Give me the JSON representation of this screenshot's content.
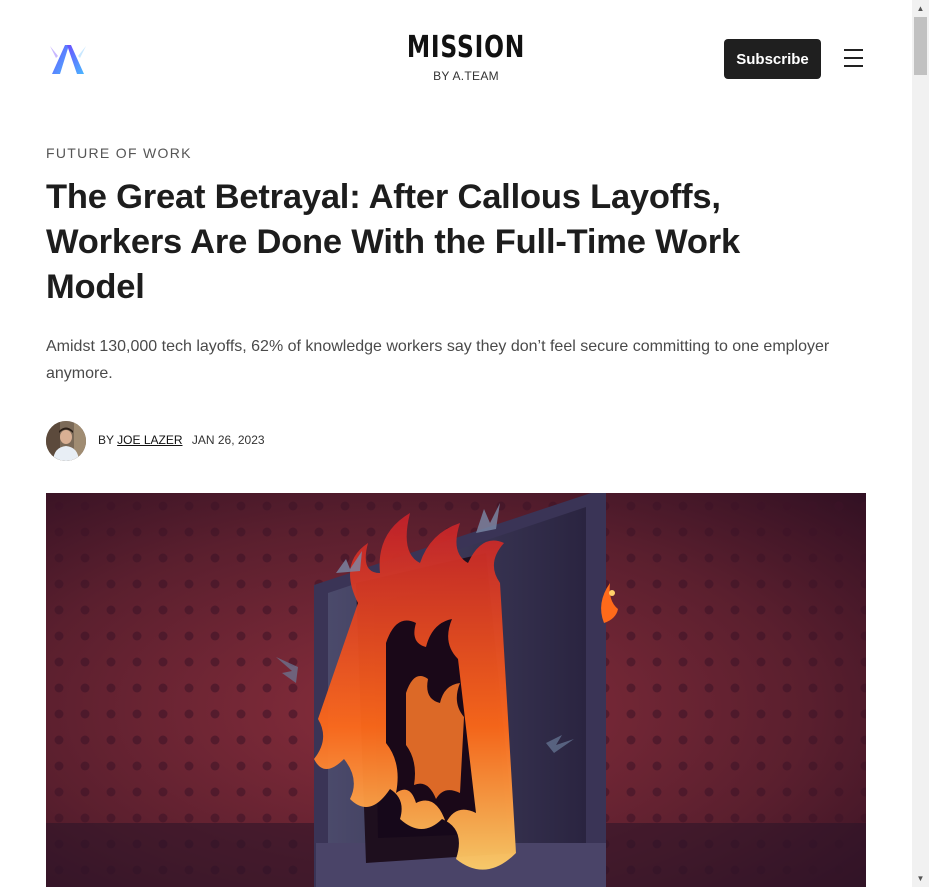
{
  "header": {
    "masthead_title": "MISSION",
    "masthead_subtitle": "BY A.TEAM",
    "subscribe_label": "Subscribe",
    "logo_icon": "a-team-logo",
    "menu_icon": "hamburger-menu-icon"
  },
  "article": {
    "category": "FUTURE OF WORK",
    "headline": "The Great Betrayal: After Callous Layoffs, Workers Are Done With the Full-Time Work Model",
    "dek": "Amidst 130,000 tech layoffs, 62% of knowledge workers say they don’t feel secure committing to one employer anymore.",
    "byline_prefix": "BY",
    "author": "JOE LAZER",
    "date": "JAN 26, 2023"
  },
  "colors": {
    "button_bg": "#1f1f1f",
    "logo_gradient_start": "#7b5cff",
    "logo_gradient_end": "#3fa9ff",
    "hero_bg": "#5a1f2c",
    "fire": "#ff6a1a"
  }
}
